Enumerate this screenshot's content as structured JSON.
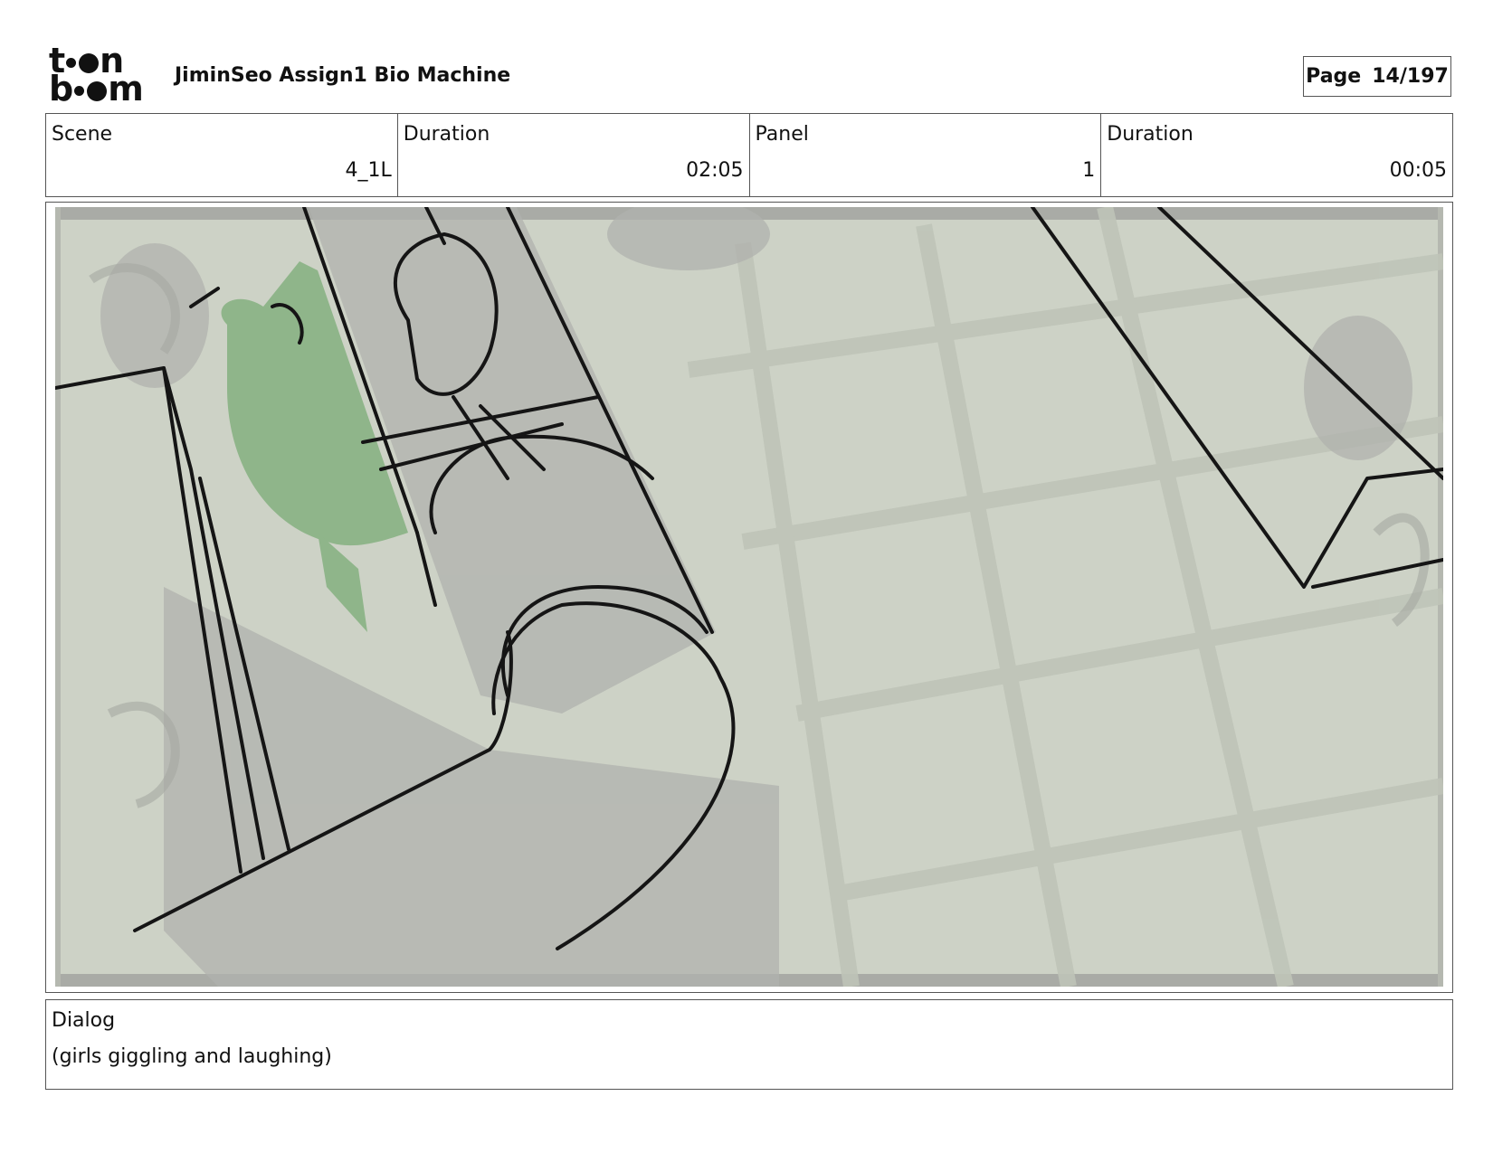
{
  "header": {
    "logo_text": "toonboom",
    "title": "JiminSeo Assign1 Bio Machine",
    "page_label": "Page",
    "page_value": "14/197"
  },
  "info": {
    "scene_label": "Scene",
    "scene_value": "4_1L",
    "scene_duration_label": "Duration",
    "scene_duration_value": "02:05",
    "panel_label": "Panel",
    "panel_value": "1",
    "panel_duration_label": "Duration",
    "panel_duration_value": "00:05"
  },
  "dialog": {
    "label": "Dialog",
    "text": "(girls giggling and laughing)"
  },
  "colors": {
    "panel_bg": "#cdd2c6",
    "character_green": "#8fb58a",
    "border": "#555555"
  }
}
